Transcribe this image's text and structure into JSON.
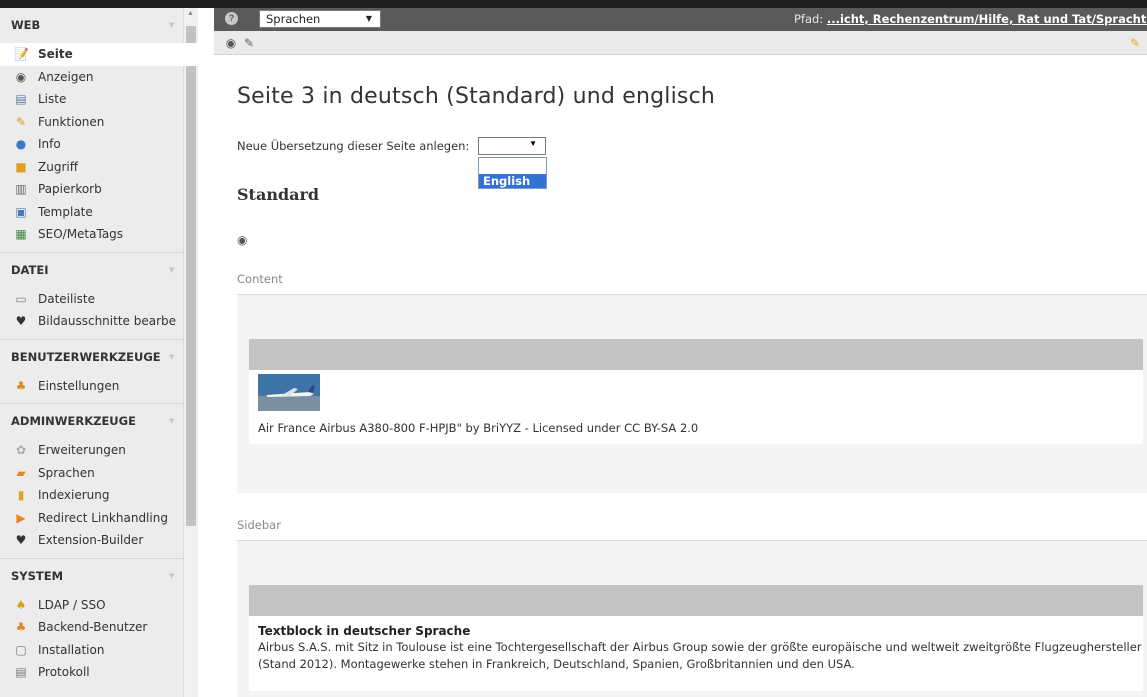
{
  "modules": {
    "groups": [
      {
        "title": "WEB",
        "items": [
          {
            "label": "Seite",
            "icon": "page-edit-icon",
            "active": true
          },
          {
            "label": "Anzeigen",
            "icon": "eye-icon"
          },
          {
            "label": "Liste",
            "icon": "list-icon"
          },
          {
            "label": "Funktionen",
            "icon": "wand-icon"
          },
          {
            "label": "Info",
            "icon": "info-icon"
          },
          {
            "label": "Zugriff",
            "icon": "lock-icon"
          },
          {
            "label": "Papierkorb",
            "icon": "trash-icon"
          },
          {
            "label": "Template",
            "icon": "template-icon"
          },
          {
            "label": "SEO/MetaTags",
            "icon": "seo-icon"
          }
        ]
      },
      {
        "title": "DATEI",
        "items": [
          {
            "label": "Dateiliste",
            "icon": "folder-icon"
          },
          {
            "label": "Bildausschnitte bearbe",
            "icon": "extension-icon"
          }
        ]
      },
      {
        "title": "BENUTZERWERKZEUGE",
        "items": [
          {
            "label": "Einstellungen",
            "icon": "user-settings-icon"
          }
        ]
      },
      {
        "title": "ADMINWERKZEUGE",
        "items": [
          {
            "label": "Erweiterungen",
            "icon": "puzzle-icon"
          },
          {
            "label": "Sprachen",
            "icon": "language-icon"
          },
          {
            "label": "Indexierung",
            "icon": "bar-chart-icon"
          },
          {
            "label": "Redirect Linkhandling",
            "icon": "redirect-icon"
          },
          {
            "label": "Extension-Builder",
            "icon": "extension-icon"
          }
        ]
      },
      {
        "title": "SYSTEM",
        "items": [
          {
            "label": "LDAP / SSO",
            "icon": "ldap-icon"
          },
          {
            "label": "Backend-Benutzer",
            "icon": "users-icon"
          },
          {
            "label": "Installation",
            "icon": "install-icon"
          },
          {
            "label": "Protokoll",
            "icon": "log-icon"
          }
        ]
      }
    ]
  },
  "docheader": {
    "view_select": "Sprachen",
    "path_label": "Pfad: ",
    "path_value": "...icht, Rechenzentrum/Hilfe, Rat und Tat/Sprachte"
  },
  "content": {
    "page_title": "Seite 3 in deutsch (Standard) und englisch",
    "new_translation_label": "Neue Übersetzung dieser Seite anlegen:",
    "language_selected": "",
    "language_option": "English",
    "standard_heading": "Standard",
    "columns": [
      {
        "label": "Content",
        "element_caption": "Air France Airbus A380-800 F-HPJB\" by BriYYZ - Licensed under CC BY-SA 2.0"
      },
      {
        "label": "Sidebar",
        "element_title": "Textblock in deutscher Sprache",
        "element_text": "Airbus S.A.S. mit Sitz in Toulouse ist eine Tochtergesellschaft der Airbus Group sowie der größte europäische und weltweit zweitgrößte Flugzeughersteller (Stand 2012). Montagewerke stehen in Frankreich, Deutschland, Spanien, Großbritannien und den USA."
      }
    ]
  },
  "colors": {
    "docheader": "#5a5a5a",
    "active_module_bg": "#ffffff",
    "dropdown_highlight": "#3370d8",
    "element_header": "#c4c4c4"
  }
}
